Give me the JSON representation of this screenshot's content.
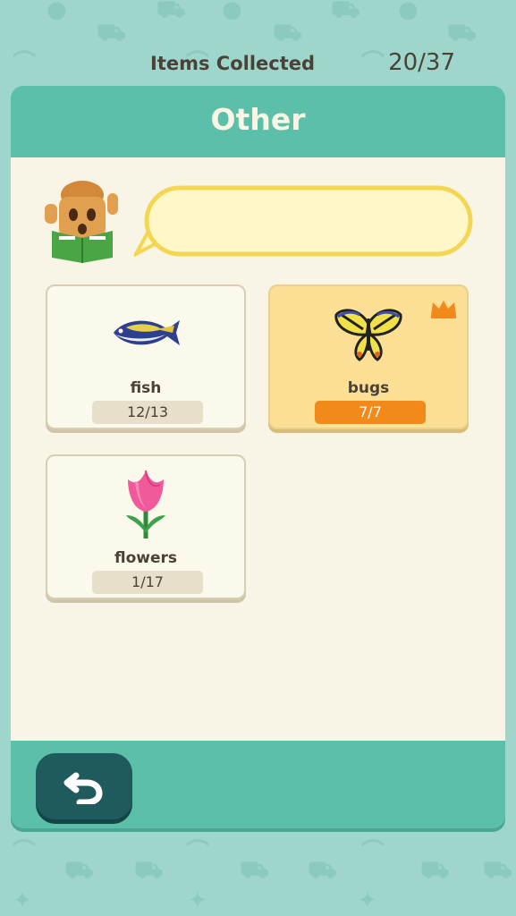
{
  "screen": {
    "title": "Other"
  },
  "summary": {
    "label": "Items Collected",
    "count": "20/37"
  },
  "categories": [
    {
      "name": "fish",
      "count": "12/13",
      "complete": false,
      "icon": "fish-icon"
    },
    {
      "name": "bugs",
      "count": "7/7",
      "complete": true,
      "icon": "butterfly-icon"
    },
    {
      "name": "flowers",
      "count": "1/17",
      "complete": false,
      "icon": "tulip-icon"
    }
  ],
  "colors": {
    "background": "#9fd6cb",
    "panel": "#5bbfa9",
    "content": "#f8f5e6",
    "complete_badge": "#f28a1b",
    "back_button": "#1f5a5c"
  }
}
